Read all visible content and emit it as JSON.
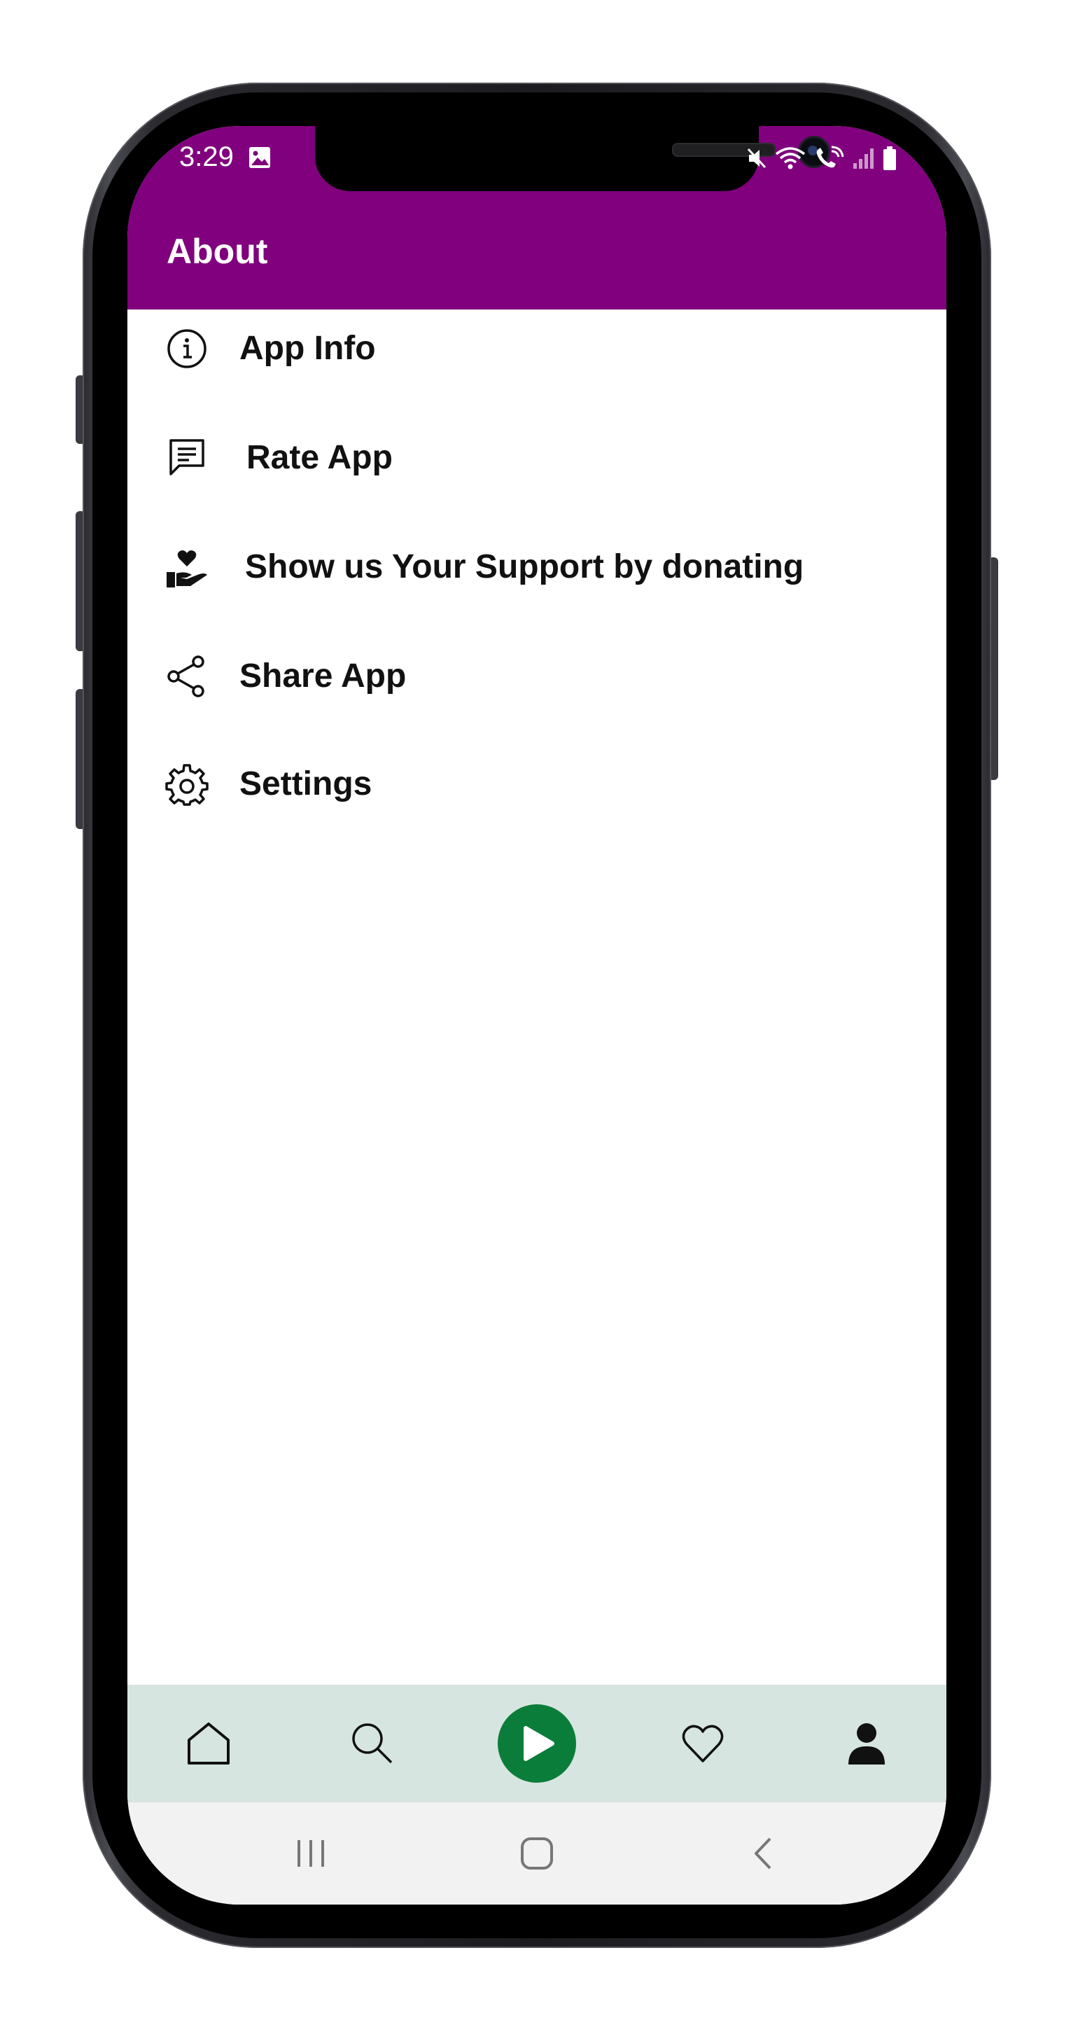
{
  "status_bar": {
    "time": "3:29"
  },
  "appbar": {
    "title": "About",
    "color": "#80007d"
  },
  "menu": {
    "items": [
      {
        "label": "App Info",
        "icon": "info-circle-icon"
      },
      {
        "label": "Rate App",
        "icon": "message-square-icon"
      },
      {
        "label": "Show us Your Support by donating",
        "icon": "hand-heart-icon"
      },
      {
        "label": "Share App",
        "icon": "share-icon"
      },
      {
        "label": "Settings",
        "icon": "gear-icon"
      }
    ]
  },
  "bottom_nav": {
    "background": "#d7e5e1",
    "play_color": "#0b7d3a",
    "items": [
      "home-icon",
      "search-icon",
      "play-icon",
      "heart-icon",
      "person-icon"
    ]
  },
  "system_nav": {
    "items": [
      "recent-apps-icon",
      "home-button-icon",
      "back-icon"
    ]
  }
}
